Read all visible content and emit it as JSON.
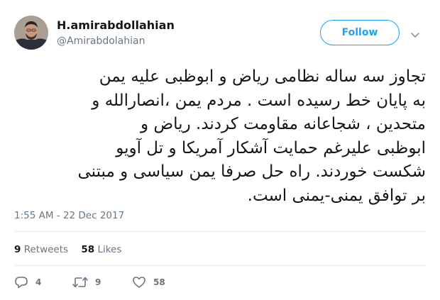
{
  "user": {
    "display_name": "H.amirabdollahian",
    "handle": "@Amirabdolahian"
  },
  "follow_label": "Follow",
  "tweet": {
    "lines": [
      "تجاوز سه ساله نظامی ریاض و ابوظبی علیه یمن",
      "به پایان خط رسیده است . مردم یمن ،انصارالله و",
      "متحدین ، شجاعانه مقاومت کردند. ریاض و",
      "ابوظبی علیرغم حمایت آشکار آمریکا و تل آویو",
      "شکست خوردند. راه حل صرفا یمن سیاسی و مبتنی",
      "بر توافق یمنی-یمنی است."
    ],
    "timestamp": "1:55 AM - 22 Dec 2017"
  },
  "stats": {
    "retweets_count": "9",
    "retweets_label": "Retweets",
    "likes_count": "58",
    "likes_label": "Likes"
  },
  "actions": {
    "reply_count": "4",
    "retweet_count": "9",
    "like_count": "58"
  },
  "colors": {
    "accent": "#1da1f2",
    "muted": "#657786",
    "text": "#14171a",
    "divider": "#e6ecf0"
  },
  "icons": [
    "avatar",
    "chevron-down-icon",
    "reply-icon",
    "retweet-icon",
    "heart-icon"
  ]
}
